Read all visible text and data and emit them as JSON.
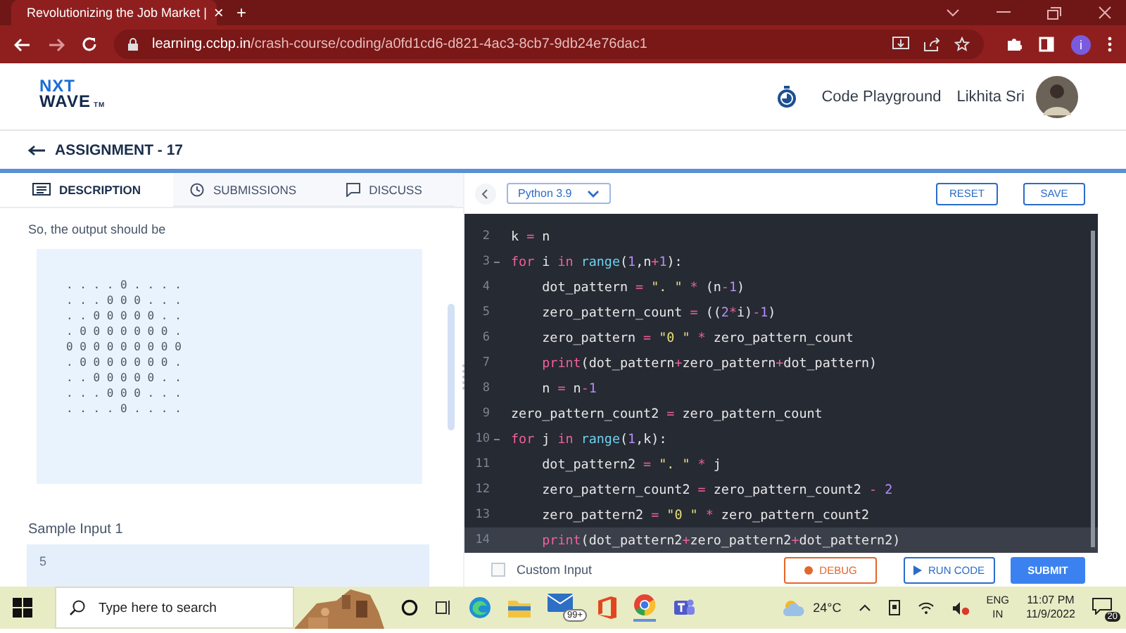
{
  "browser": {
    "tab_title": "Revolutionizing the Job Market |",
    "tab_close": "×",
    "new_tab": "+",
    "url_host": "learning.ccbp.in",
    "url_path": "/crash-course/coding/a0fd1cd6-d821-4ac3-8cb7-9db24e76dac1",
    "profile_initial": "i"
  },
  "header": {
    "logo_top": "NXT",
    "logo_bottom": "WAVE",
    "logo_mark": "TM",
    "nav_link": "Code Playground",
    "user_name": "Likhita Sri"
  },
  "assignment_title": "ASSIGNMENT - 17",
  "left_tabs": [
    {
      "label": "DESCRIPTION",
      "selected": true
    },
    {
      "label": "SUBMISSIONS",
      "selected": false
    },
    {
      "label": "DISCUSS",
      "selected": false
    }
  ],
  "description": {
    "intro": "So, the output should be",
    "pattern": [
      ". . . . 0 . . . .",
      ". . . 0 0 0 . . .",
      ". . 0 0 0 0 0 . .",
      ". 0 0 0 0 0 0 0 .",
      "0 0 0 0 0 0 0 0 0",
      ". 0 0 0 0 0 0 0 .",
      ". . 0 0 0 0 0 . .",
      ". . . 0 0 0 . . .",
      ". . . . 0 . . . ."
    ],
    "sample_heading": "Sample Input 1",
    "sample_value": "5"
  },
  "editor": {
    "language": "Python 3.9",
    "reset": "RESET",
    "save": "SAVE",
    "lines": [
      {
        "num": "2",
        "fold": false,
        "active": false,
        "tokens": [
          {
            "kind": "plain",
            "text": "k "
          },
          {
            "kind": "operator",
            "text": "="
          },
          {
            "kind": "plain",
            "text": " n"
          }
        ]
      },
      {
        "num": "3",
        "fold": true,
        "active": false,
        "tokens": [
          {
            "kind": "keyword",
            "text": "for"
          },
          {
            "kind": "plain",
            "text": " i "
          },
          {
            "kind": "keyword",
            "text": "in"
          },
          {
            "kind": "builtin",
            "text": " range"
          },
          {
            "kind": "plain",
            "text": "("
          },
          {
            "kind": "number",
            "text": "1"
          },
          {
            "kind": "plain",
            "text": ",n"
          },
          {
            "kind": "operator",
            "text": "+"
          },
          {
            "kind": "number",
            "text": "1"
          },
          {
            "kind": "plain",
            "text": "):"
          }
        ]
      },
      {
        "num": "4",
        "fold": false,
        "active": false,
        "tokens": [
          {
            "kind": "plain",
            "text": "    dot_pattern "
          },
          {
            "kind": "operator",
            "text": "="
          },
          {
            "kind": "string",
            "text": " \". \""
          },
          {
            "kind": "operator",
            "text": " *"
          },
          {
            "kind": "plain",
            "text": " (n"
          },
          {
            "kind": "operator",
            "text": "-"
          },
          {
            "kind": "number",
            "text": "1"
          },
          {
            "kind": "plain",
            "text": ")"
          }
        ]
      },
      {
        "num": "5",
        "fold": false,
        "active": false,
        "tokens": [
          {
            "kind": "plain",
            "text": "    zero_pattern_count "
          },
          {
            "kind": "operator",
            "text": "="
          },
          {
            "kind": "plain",
            "text": " (("
          },
          {
            "kind": "number",
            "text": "2"
          },
          {
            "kind": "operator",
            "text": "*"
          },
          {
            "kind": "plain",
            "text": "i)"
          },
          {
            "kind": "operator",
            "text": "-"
          },
          {
            "kind": "number",
            "text": "1"
          },
          {
            "kind": "plain",
            "text": ")"
          }
        ]
      },
      {
        "num": "6",
        "fold": false,
        "active": false,
        "tokens": [
          {
            "kind": "plain",
            "text": "    zero_pattern "
          },
          {
            "kind": "operator",
            "text": "="
          },
          {
            "kind": "string",
            "text": " \"0 \""
          },
          {
            "kind": "operator",
            "text": " *"
          },
          {
            "kind": "plain",
            "text": " zero_pattern_count"
          }
        ]
      },
      {
        "num": "7",
        "fold": false,
        "active": false,
        "tokens": [
          {
            "kind": "keyword",
            "text": "    print"
          },
          {
            "kind": "plain",
            "text": "(dot_pattern"
          },
          {
            "kind": "operator",
            "text": "+"
          },
          {
            "kind": "plain",
            "text": "zero_pattern"
          },
          {
            "kind": "operator",
            "text": "+"
          },
          {
            "kind": "plain",
            "text": "dot_pattern)"
          }
        ]
      },
      {
        "num": "8",
        "fold": false,
        "active": false,
        "tokens": [
          {
            "kind": "plain",
            "text": "    n "
          },
          {
            "kind": "operator",
            "text": "="
          },
          {
            "kind": "plain",
            "text": " n"
          },
          {
            "kind": "operator",
            "text": "-"
          },
          {
            "kind": "number",
            "text": "1"
          }
        ]
      },
      {
        "num": "9",
        "fold": false,
        "active": false,
        "tokens": [
          {
            "kind": "plain",
            "text": "zero_pattern_count2 "
          },
          {
            "kind": "operator",
            "text": "="
          },
          {
            "kind": "plain",
            "text": " zero_pattern_count"
          }
        ]
      },
      {
        "num": "10",
        "fold": true,
        "active": false,
        "tokens": [
          {
            "kind": "keyword",
            "text": "for"
          },
          {
            "kind": "plain",
            "text": " j "
          },
          {
            "kind": "keyword",
            "text": "in"
          },
          {
            "kind": "builtin",
            "text": " range"
          },
          {
            "kind": "plain",
            "text": "("
          },
          {
            "kind": "number",
            "text": "1"
          },
          {
            "kind": "plain",
            "text": ",k):"
          }
        ]
      },
      {
        "num": "11",
        "fold": false,
        "active": false,
        "tokens": [
          {
            "kind": "plain",
            "text": "    dot_pattern2 "
          },
          {
            "kind": "operator",
            "text": "="
          },
          {
            "kind": "string",
            "text": " \". \""
          },
          {
            "kind": "operator",
            "text": " *"
          },
          {
            "kind": "plain",
            "text": " j"
          }
        ]
      },
      {
        "num": "12",
        "fold": false,
        "active": false,
        "tokens": [
          {
            "kind": "plain",
            "text": "    zero_pattern_count2 "
          },
          {
            "kind": "operator",
            "text": "="
          },
          {
            "kind": "plain",
            "text": " zero_pattern_count2 "
          },
          {
            "kind": "operator",
            "text": "-"
          },
          {
            "kind": "number",
            "text": " 2"
          }
        ]
      },
      {
        "num": "13",
        "fold": false,
        "active": false,
        "tokens": [
          {
            "kind": "plain",
            "text": "    zero_pattern2 "
          },
          {
            "kind": "operator",
            "text": "="
          },
          {
            "kind": "string",
            "text": " \"0 \""
          },
          {
            "kind": "operator",
            "text": " *"
          },
          {
            "kind": "plain",
            "text": " zero_pattern_count2"
          }
        ]
      },
      {
        "num": "14",
        "fold": false,
        "active": true,
        "tokens": [
          {
            "kind": "keyword",
            "text": "    print"
          },
          {
            "kind": "plain",
            "text": "(dot_pattern2"
          },
          {
            "kind": "operator",
            "text": "+"
          },
          {
            "kind": "plain",
            "text": "zero_pattern2"
          },
          {
            "kind": "operator",
            "text": "+"
          },
          {
            "kind": "plain",
            "text": "dot_pattern2)"
          }
        ]
      }
    ],
    "custom_input": {
      "label": "Custom Input",
      "checked": false
    },
    "debug": "DEBUG",
    "run": "RUN CODE",
    "submit": "SUBMIT"
  },
  "taskbar": {
    "search_placeholder": "Type here to search",
    "mail_badge": "99+",
    "weather": "24°C",
    "lang_top": "ENG",
    "lang_bottom": "IN",
    "time": "11:07 PM",
    "date": "11/9/2022",
    "notifications": "20"
  }
}
